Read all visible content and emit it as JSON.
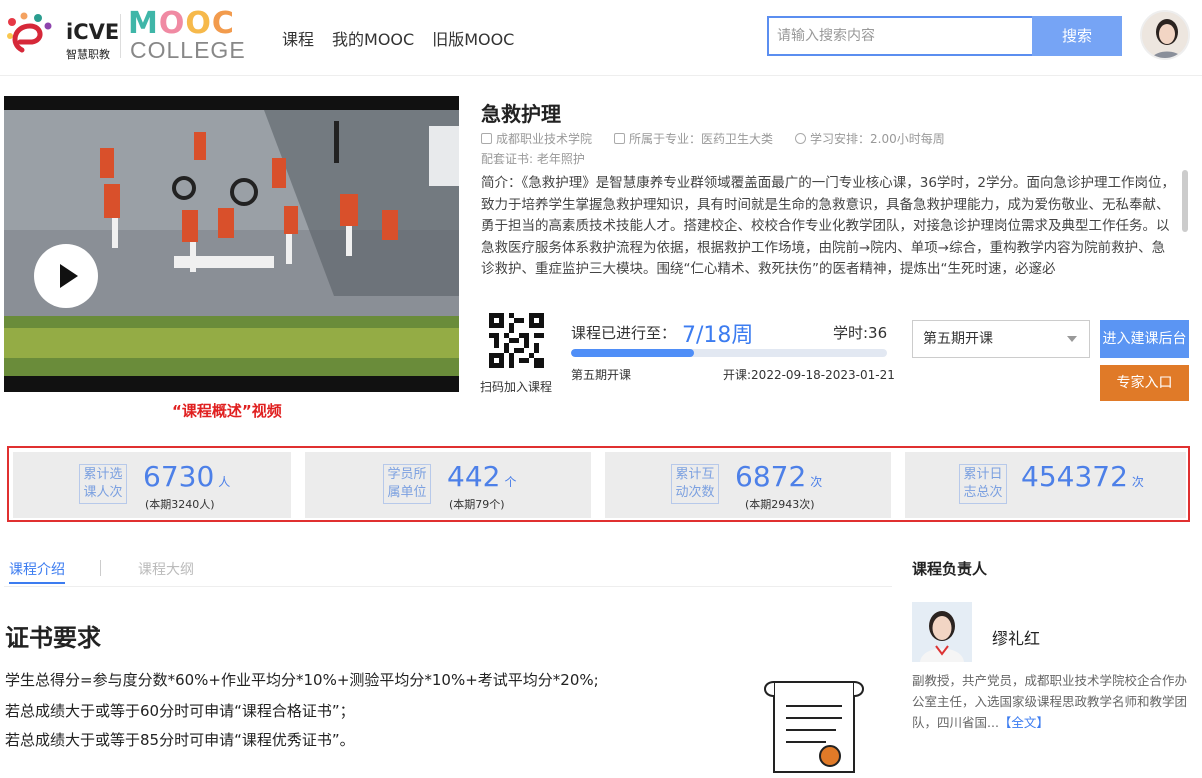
{
  "header": {
    "logo_icve_text": "iCVE",
    "logo_icve_sub": "智慧职教",
    "logo_mooc_text": "MOOC",
    "logo_college_text": "COLLEGE",
    "nav": [
      "课程",
      "我的MOOC",
      "旧版MOOC"
    ],
    "search_placeholder": "请输入搜索内容",
    "search_button": "搜索"
  },
  "video": {
    "caption": "“课程概述”视频"
  },
  "course": {
    "title": "急救护理",
    "school": "成都职业技术学院",
    "major": "所属于专业：医药卫生大类",
    "schedule": "学习安排：2.00小时每周",
    "certificate": "配套证书: 老年照护",
    "intro": "简介：《急救护理》是智慧康养专业群领域覆盖面最广的一门专业核心课，36学时，2学分。面向急诊护理工作岗位，致力于培养学生掌握急救护理知识，具有时间就是生命的急救意识，具备急救护理能力，成为爱伤敬业、无私奉献、勇于担当的高素质技术技能人才。搭建校企、校校合作专业化教学团队，对接急诊护理岗位需求及典型工作任务。以急救医疗服务体系救护流程为依据，根据救护工作场境，由院前→院内、单项→综合，重构教学内容为院前救护、急诊救护、重症监护三大模块。围绕“仁心精术、救死扶伤”的医者精神，提炼出“生死时速，必邃必"
  },
  "enroll": {
    "qr_label": "扫码加入课程",
    "progress_label": "课程已进行至：",
    "progress_value": "7/18周",
    "progress_fraction": 0.389,
    "hours": "学时:36",
    "term": "第五期开课",
    "dates": "开课:2022-09-18-2023-01-21",
    "term_select": "第五期开课",
    "enter_button": "进入建课后台",
    "expert_button": "专家入口"
  },
  "stats": [
    {
      "label": "累计选课人次",
      "num": "6730",
      "unit": "人",
      "sub": "(本期3240人)"
    },
    {
      "label": "学员所属单位",
      "num": "442",
      "unit": "个",
      "sub": "(本期79个)"
    },
    {
      "label": "累计互动次数",
      "num": "6872",
      "unit": "次",
      "sub": "(本期2943次)"
    },
    {
      "label": "累计日志总次",
      "num": "454372",
      "unit": "次",
      "sub": ""
    }
  ],
  "tabs": {
    "active": "课程介绍",
    "inactive": "课程大纲"
  },
  "cert_section": {
    "title": "证书要求",
    "lines": [
      "学生总得分=参与度分数*60%+作业平均分*10%+测验平均分*10%+考试平均分*20%;",
      "若总成绩大于或等于60分时可申请“课程合格证书”；",
      "若总成绩大于或等于85分时可申请“课程优秀证书”。"
    ]
  },
  "owner": {
    "title": "课程负责人",
    "name": "缪礼红",
    "desc": "副教授，共产党员，成都职业技术学院校企合作办公室主任，入选国家级课程思政教学名师和教学团队，四川省国...",
    "fulltext": "【全文】"
  },
  "colors": {
    "accent": "#3c7cf0",
    "expert": "#e07a28",
    "highlight_border": "#e03030"
  }
}
